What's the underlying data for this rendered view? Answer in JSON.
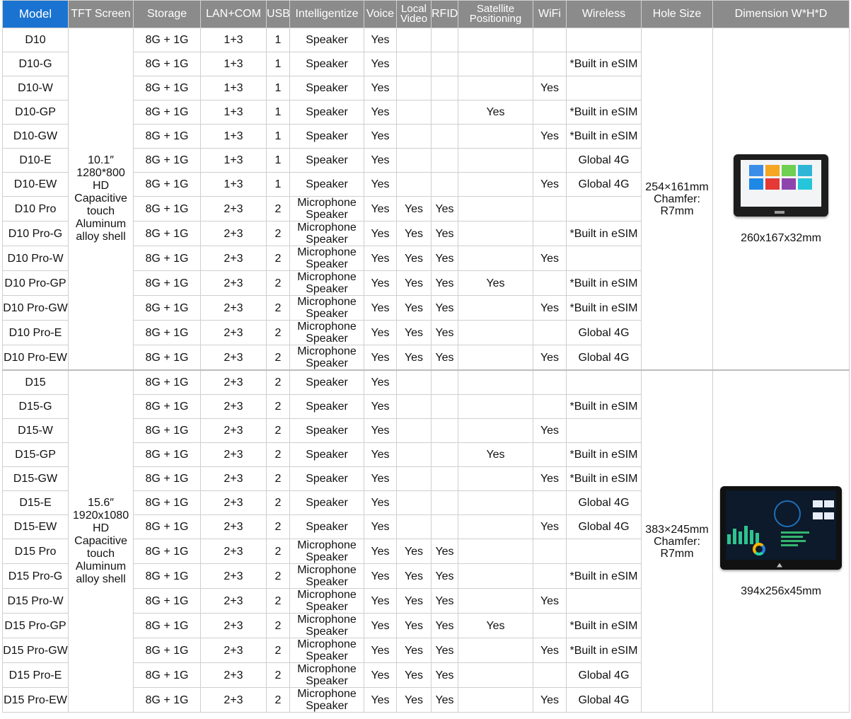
{
  "headers": {
    "model": "Model",
    "tft": "TFT Screen",
    "storage": "Storage",
    "lan": "LAN+COM",
    "usb": "USB",
    "intel": "Intelligentize",
    "voice": "Voice",
    "local_video": "Local Video",
    "rfid": "RFID",
    "satellite": "Satellite Positioning",
    "wifi": "WiFi",
    "wireless": "Wireless",
    "hole": "Hole Size",
    "dimension": "Dimension W*H*D"
  },
  "groups": [
    {
      "screen": [
        "10.1″",
        "1280*800",
        "HD",
        "Capacitive",
        "touch",
        "Aluminum",
        "alloy shell"
      ],
      "hole": [
        "254×161mm",
        "Chamfer:",
        "R7mm"
      ],
      "dimension": "260x167x32mm",
      "image_icon": "d10-device-image",
      "rows": [
        {
          "model": "D10",
          "storage": "8G + 1G",
          "lan": "1+3",
          "usb": "1",
          "intel": [
            "Speaker"
          ],
          "voice": "Yes",
          "local_video": "",
          "rfid": "",
          "satellite": "",
          "wifi": "",
          "wireless": ""
        },
        {
          "model": "D10-G",
          "storage": "8G + 1G",
          "lan": "1+3",
          "usb": "1",
          "intel": [
            "Speaker"
          ],
          "voice": "Yes",
          "local_video": "",
          "rfid": "",
          "satellite": "",
          "wifi": "",
          "wireless": "*Built in eSIM"
        },
        {
          "model": "D10-W",
          "storage": "8G + 1G",
          "lan": "1+3",
          "usb": "1",
          "intel": [
            "Speaker"
          ],
          "voice": "Yes",
          "local_video": "",
          "rfid": "",
          "satellite": "",
          "wifi": "Yes",
          "wireless": ""
        },
        {
          "model": "D10-GP",
          "storage": "8G + 1G",
          "lan": "1+3",
          "usb": "1",
          "intel": [
            "Speaker"
          ],
          "voice": "Yes",
          "local_video": "",
          "rfid": "",
          "satellite": "Yes",
          "wifi": "",
          "wireless": "*Built in eSIM"
        },
        {
          "model": "D10-GW",
          "storage": "8G + 1G",
          "lan": "1+3",
          "usb": "1",
          "intel": [
            "Speaker"
          ],
          "voice": "Yes",
          "local_video": "",
          "rfid": "",
          "satellite": "",
          "wifi": "Yes",
          "wireless": "*Built in eSIM"
        },
        {
          "model": "D10-E",
          "storage": "8G + 1G",
          "lan": "1+3",
          "usb": "1",
          "intel": [
            "Speaker"
          ],
          "voice": "Yes",
          "local_video": "",
          "rfid": "",
          "satellite": "",
          "wifi": "",
          "wireless": "Global 4G"
        },
        {
          "model": "D10-EW",
          "storage": "8G + 1G",
          "lan": "1+3",
          "usb": "1",
          "intel": [
            "Speaker"
          ],
          "voice": "Yes",
          "local_video": "",
          "rfid": "",
          "satellite": "",
          "wifi": "Yes",
          "wireless": "Global 4G"
        },
        {
          "model": "D10 Pro",
          "storage": "8G + 1G",
          "lan": "2+3",
          "usb": "2",
          "intel": [
            "Microphone",
            "Speaker"
          ],
          "voice": "Yes",
          "local_video": "Yes",
          "rfid": "Yes",
          "satellite": "",
          "wifi": "",
          "wireless": ""
        },
        {
          "model": "D10 Pro-G",
          "storage": "8G + 1G",
          "lan": "2+3",
          "usb": "2",
          "intel": [
            "Microphone",
            "Speaker"
          ],
          "voice": "Yes",
          "local_video": "Yes",
          "rfid": "Yes",
          "satellite": "",
          "wifi": "",
          "wireless": "*Built in eSIM"
        },
        {
          "model": "D10 Pro-W",
          "storage": "8G + 1G",
          "lan": "2+3",
          "usb": "2",
          "intel": [
            "Microphone",
            "Speaker"
          ],
          "voice": "Yes",
          "local_video": "Yes",
          "rfid": "Yes",
          "satellite": "",
          "wifi": "Yes",
          "wireless": ""
        },
        {
          "model": "D10 Pro-GP",
          "storage": "8G + 1G",
          "lan": "2+3",
          "usb": "2",
          "intel": [
            "Microphone",
            "Speaker"
          ],
          "voice": "Yes",
          "local_video": "Yes",
          "rfid": "Yes",
          "satellite": "Yes",
          "wifi": "",
          "wireless": "*Built in eSIM"
        },
        {
          "model": "D10 Pro-GW",
          "storage": "8G + 1G",
          "lan": "2+3",
          "usb": "2",
          "intel": [
            "Microphone",
            "Speaker"
          ],
          "voice": "Yes",
          "local_video": "Yes",
          "rfid": "Yes",
          "satellite": "",
          "wifi": "Yes",
          "wireless": "*Built in eSIM"
        },
        {
          "model": "D10 Pro-E",
          "storage": "8G + 1G",
          "lan": "2+3",
          "usb": "2",
          "intel": [
            "Microphone",
            "Speaker"
          ],
          "voice": "Yes",
          "local_video": "Yes",
          "rfid": "Yes",
          "satellite": "",
          "wifi": "",
          "wireless": "Global 4G"
        },
        {
          "model": "D10 Pro-EW",
          "storage": "8G + 1G",
          "lan": "2+3",
          "usb": "2",
          "intel": [
            "Microphone",
            "Speaker"
          ],
          "voice": "Yes",
          "local_video": "Yes",
          "rfid": "Yes",
          "satellite": "",
          "wifi": "Yes",
          "wireless": "Global 4G"
        }
      ]
    },
    {
      "screen": [
        "15.6″",
        "1920x1080",
        "HD",
        "Capacitive",
        "touch",
        "Aluminum",
        "alloy shell"
      ],
      "hole": [
        "383×245mm",
        "Chamfer:",
        "R7mm"
      ],
      "dimension": "394x256x45mm",
      "image_icon": "d15-device-image",
      "rows": [
        {
          "model": "D15",
          "storage": "8G + 1G",
          "lan": "2+3",
          "usb": "2",
          "intel": [
            "Speaker"
          ],
          "voice": "Yes",
          "local_video": "",
          "rfid": "",
          "satellite": "",
          "wifi": "",
          "wireless": ""
        },
        {
          "model": "D15-G",
          "storage": "8G + 1G",
          "lan": "2+3",
          "usb": "2",
          "intel": [
            "Speaker"
          ],
          "voice": "Yes",
          "local_video": "",
          "rfid": "",
          "satellite": "",
          "wifi": "",
          "wireless": "*Built in eSIM"
        },
        {
          "model": "D15-W",
          "storage": "8G + 1G",
          "lan": "2+3",
          "usb": "2",
          "intel": [
            "Speaker"
          ],
          "voice": "Yes",
          "local_video": "",
          "rfid": "",
          "satellite": "",
          "wifi": "Yes",
          "wireless": ""
        },
        {
          "model": "D15-GP",
          "storage": "8G + 1G",
          "lan": "2+3",
          "usb": "2",
          "intel": [
            "Speaker"
          ],
          "voice": "Yes",
          "local_video": "",
          "rfid": "",
          "satellite": "Yes",
          "wifi": "",
          "wireless": "*Built in eSIM"
        },
        {
          "model": "D15-GW",
          "storage": "8G + 1G",
          "lan": "2+3",
          "usb": "2",
          "intel": [
            "Speaker"
          ],
          "voice": "Yes",
          "local_video": "",
          "rfid": "",
          "satellite": "",
          "wifi": "Yes",
          "wireless": "*Built in eSIM"
        },
        {
          "model": "D15-E",
          "storage": "8G + 1G",
          "lan": "2+3",
          "usb": "2",
          "intel": [
            "Speaker"
          ],
          "voice": "Yes",
          "local_video": "",
          "rfid": "",
          "satellite": "",
          "wifi": "",
          "wireless": "Global 4G"
        },
        {
          "model": "D15-EW",
          "storage": "8G + 1G",
          "lan": "2+3",
          "usb": "2",
          "intel": [
            "Speaker"
          ],
          "voice": "Yes",
          "local_video": "",
          "rfid": "",
          "satellite": "",
          "wifi": "Yes",
          "wireless": "Global 4G"
        },
        {
          "model": "D15 Pro",
          "storage": "8G + 1G",
          "lan": "2+3",
          "usb": "2",
          "intel": [
            "Microphone",
            "Speaker"
          ],
          "voice": "Yes",
          "local_video": "Yes",
          "rfid": "Yes",
          "satellite": "",
          "wifi": "",
          "wireless": ""
        },
        {
          "model": "D15 Pro-G",
          "storage": "8G + 1G",
          "lan": "2+3",
          "usb": "2",
          "intel": [
            "Microphone",
            "Speaker"
          ],
          "voice": "Yes",
          "local_video": "Yes",
          "rfid": "Yes",
          "satellite": "",
          "wifi": "",
          "wireless": "*Built in eSIM"
        },
        {
          "model": "D15 Pro-W",
          "storage": "8G + 1G",
          "lan": "2+3",
          "usb": "2",
          "intel": [
            "Microphone",
            "Speaker"
          ],
          "voice": "Yes",
          "local_video": "Yes",
          "rfid": "Yes",
          "satellite": "",
          "wifi": "Yes",
          "wireless": ""
        },
        {
          "model": "D15 Pro-GP",
          "storage": "8G + 1G",
          "lan": "2+3",
          "usb": "2",
          "intel": [
            "Microphone",
            "Speaker"
          ],
          "voice": "Yes",
          "local_video": "Yes",
          "rfid": "Yes",
          "satellite": "Yes",
          "wifi": "",
          "wireless": "*Built in eSIM"
        },
        {
          "model": "D15 Pro-GW",
          "storage": "8G + 1G",
          "lan": "2+3",
          "usb": "2",
          "intel": [
            "Microphone",
            "Speaker"
          ],
          "voice": "Yes",
          "local_video": "Yes",
          "rfid": "Yes",
          "satellite": "",
          "wifi": "Yes",
          "wireless": "*Built in eSIM"
        },
        {
          "model": "D15 Pro-E",
          "storage": "8G + 1G",
          "lan": "2+3",
          "usb": "2",
          "intel": [
            "Microphone",
            "Speaker"
          ],
          "voice": "Yes",
          "local_video": "Yes",
          "rfid": "Yes",
          "satellite": "",
          "wifi": "",
          "wireless": "Global 4G"
        },
        {
          "model": "D15 Pro-EW",
          "storage": "8G + 1G",
          "lan": "2+3",
          "usb": "2",
          "intel": [
            "Microphone",
            "Speaker"
          ],
          "voice": "Yes",
          "local_video": "Yes",
          "rfid": "Yes",
          "satellite": "",
          "wifi": "Yes",
          "wireless": "Global 4G"
        }
      ]
    }
  ],
  "colors": {
    "model_header": "#1a73d0",
    "header": "#8b8b8b",
    "grid": "#cfcfcf"
  }
}
